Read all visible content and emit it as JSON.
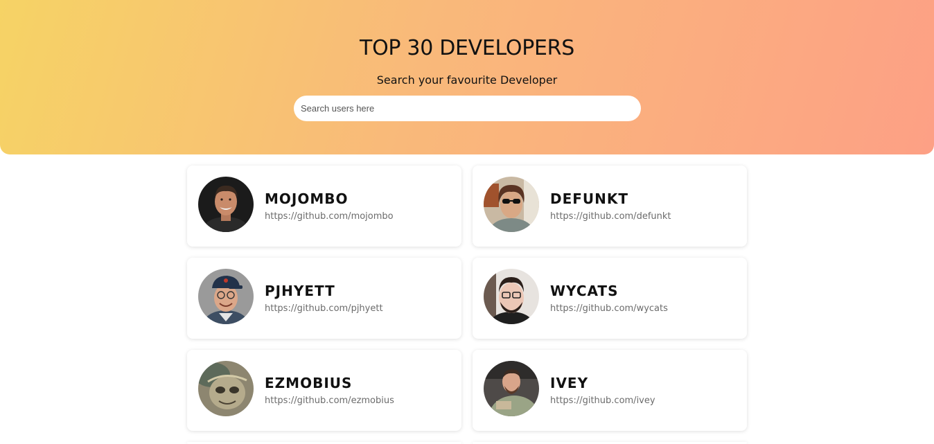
{
  "header": {
    "title": "TOP 30 DEVELOPERS",
    "subtitle": "Search your favourite Developer",
    "search_placeholder": "Search users here",
    "gradient_start": "#f6d365",
    "gradient_end": "#fda085"
  },
  "developers": [
    {
      "name": "MOJOMBO",
      "url": "https://github.com/mojombo",
      "avatar_icon": "avatar-photo"
    },
    {
      "name": "DEFUNKT",
      "url": "https://github.com/defunkt",
      "avatar_icon": "avatar-photo"
    },
    {
      "name": "PJHYETT",
      "url": "https://github.com/pjhyett",
      "avatar_icon": "avatar-photo"
    },
    {
      "name": "WYCATS",
      "url": "https://github.com/wycats",
      "avatar_icon": "avatar-photo"
    },
    {
      "name": "EZMOBIUS",
      "url": "https://github.com/ezmobius",
      "avatar_icon": "avatar-photo"
    },
    {
      "name": "IVEY",
      "url": "https://github.com/ivey",
      "avatar_icon": "avatar-photo"
    }
  ]
}
